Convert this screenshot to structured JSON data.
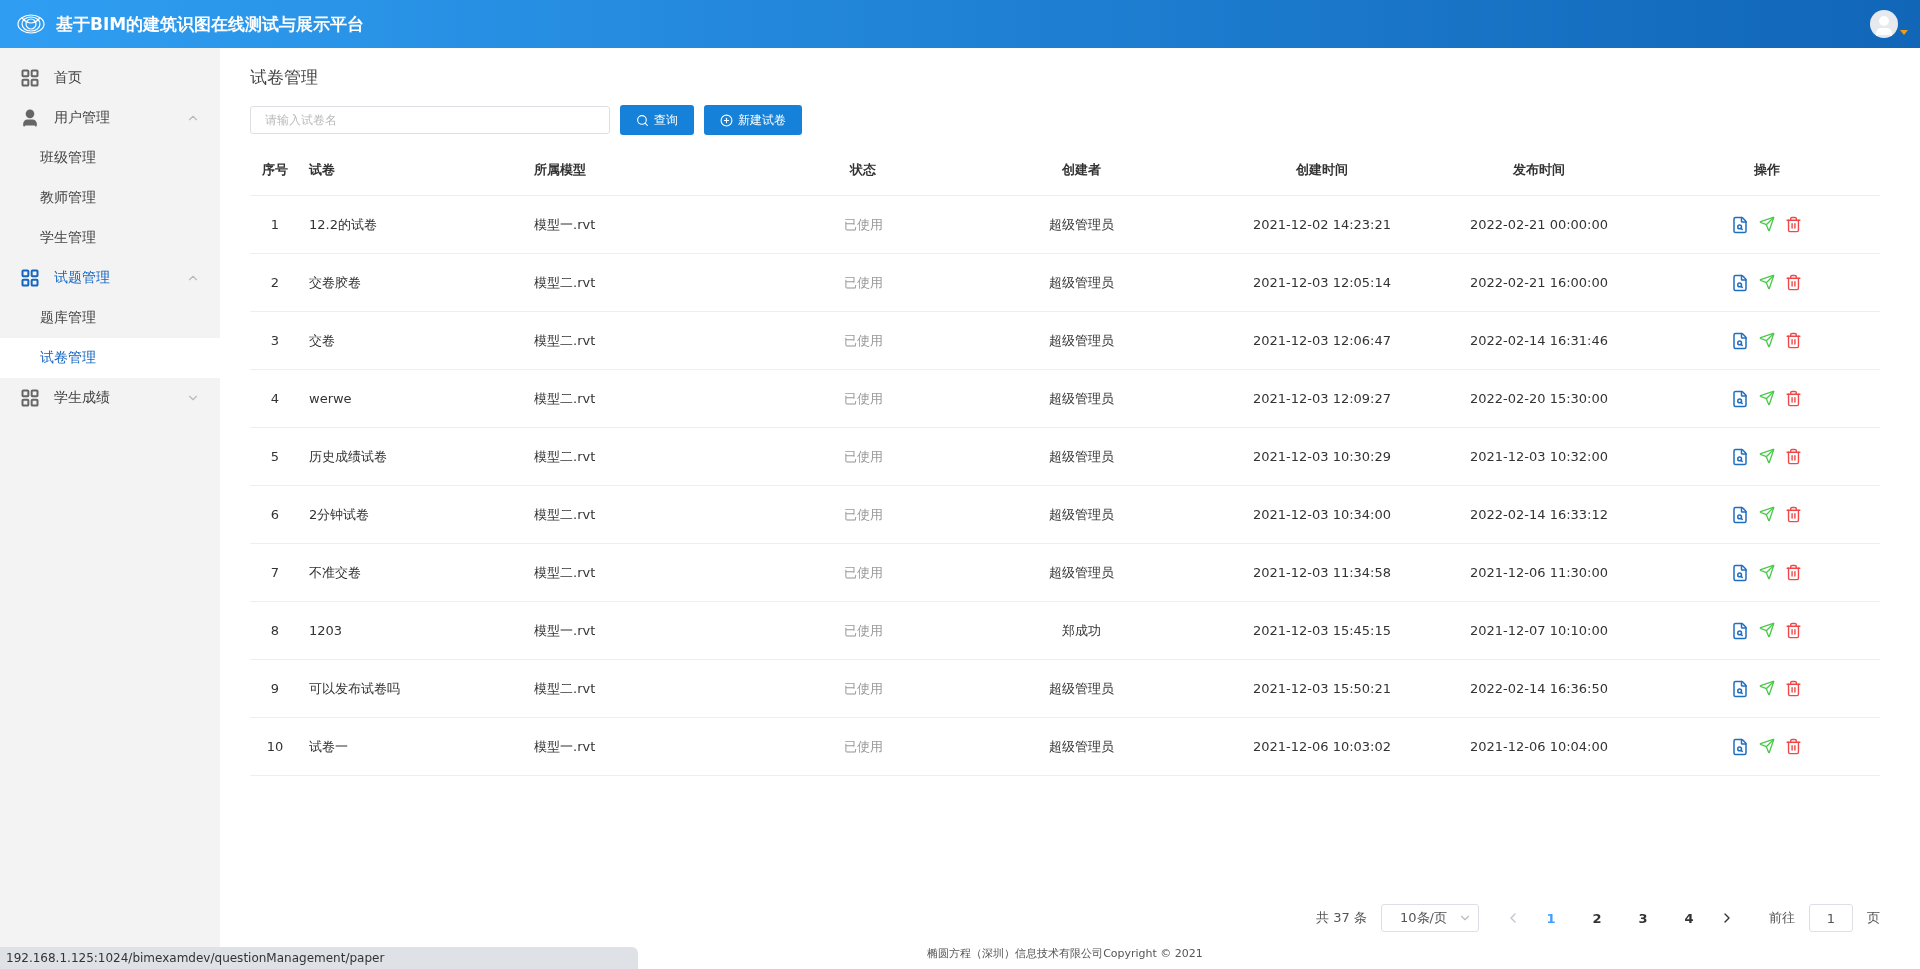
{
  "header": {
    "title": "基于BIM的建筑识图在线测试与展示平台"
  },
  "sidebar": {
    "items": [
      {
        "label": "首页",
        "selected": false
      },
      {
        "label": "用户管理",
        "selected": false,
        "expanded": true,
        "children": [
          {
            "label": "班级管理",
            "selected": false
          },
          {
            "label": "教师管理",
            "selected": false
          },
          {
            "label": "学生管理",
            "selected": false
          }
        ]
      },
      {
        "label": "试题管理",
        "selected": true,
        "expanded": true,
        "children": [
          {
            "label": "题库管理",
            "selected": false
          },
          {
            "label": "试卷管理",
            "selected": true
          }
        ]
      },
      {
        "label": "学生成绩",
        "selected": false,
        "expanded": false
      }
    ]
  },
  "page": {
    "title": "试卷管理"
  },
  "toolbar": {
    "search": {
      "placeholder": "请输入试卷名"
    },
    "buttons": [
      "查询",
      "新建试卷"
    ]
  },
  "table": {
    "columns": [
      "序号",
      "试卷",
      "所属模型",
      "状态",
      "创建者",
      "创建时间",
      "发布时间",
      "操作"
    ],
    "rows": [
      [
        "1",
        "12.2的试卷",
        "模型一.rvt",
        "已使用",
        "超级管理员",
        "2021-12-02 14:23:21",
        "2022-02-21 00:00:00"
      ],
      [
        "2",
        "交卷胶卷",
        "模型二.rvt",
        "已使用",
        "超级管理员",
        "2021-12-03 12:05:14",
        "2022-02-21 16:00:00"
      ],
      [
        "3",
        "交卷",
        "模型二.rvt",
        "已使用",
        "超级管理员",
        "2021-12-03 12:06:47",
        "2022-02-14 16:31:46"
      ],
      [
        "4",
        "werwe",
        "模型二.rvt",
        "已使用",
        "超级管理员",
        "2021-12-03 12:09:27",
        "2022-02-20 15:30:00"
      ],
      [
        "5",
        "历史成绩试卷",
        "模型二.rvt",
        "已使用",
        "超级管理员",
        "2021-12-03 10:30:29",
        "2021-12-03 10:32:00"
      ],
      [
        "6",
        "2分钟试卷",
        "模型二.rvt",
        "已使用",
        "超级管理员",
        "2021-12-03 10:34:00",
        "2022-02-14 16:33:12"
      ],
      [
        "7",
        "不准交卷",
        "模型二.rvt",
        "已使用",
        "超级管理员",
        "2021-12-03 11:34:58",
        "2021-12-06 11:30:00"
      ],
      [
        "8",
        "1203",
        "模型一.rvt",
        "已使用",
        "郑成功",
        "2021-12-03 15:45:15",
        "2021-12-07 10:10:00"
      ],
      [
        "9",
        "可以发布试卷吗",
        "模型二.rvt",
        "已使用",
        "超级管理员",
        "2021-12-03 15:50:21",
        "2022-02-14 16:36:50"
      ],
      [
        "10",
        "试卷一",
        "模型一.rvt",
        "已使用",
        "超级管理员",
        "2021-12-06 10:03:02",
        "2021-12-06 10:04:00"
      ]
    ]
  },
  "pagination": {
    "total": "共 37 条",
    "page_size": "10条/页",
    "prev_disabled": true,
    "pages": [
      {
        "label": "1",
        "selected": true
      },
      {
        "label": "2",
        "selected": false
      },
      {
        "label": "3",
        "selected": false
      },
      {
        "label": "4",
        "selected": false
      }
    ],
    "goto_label": "前往",
    "goto_value": "1",
    "goto_suffix": "页"
  },
  "footer": {
    "copyright": "椭圆方程（深圳）信息技术有限公司Copyright © 2021"
  },
  "browser_status": {
    "url": "192.168.1.125:1024/bimexamdev/questionManagement/paper"
  }
}
